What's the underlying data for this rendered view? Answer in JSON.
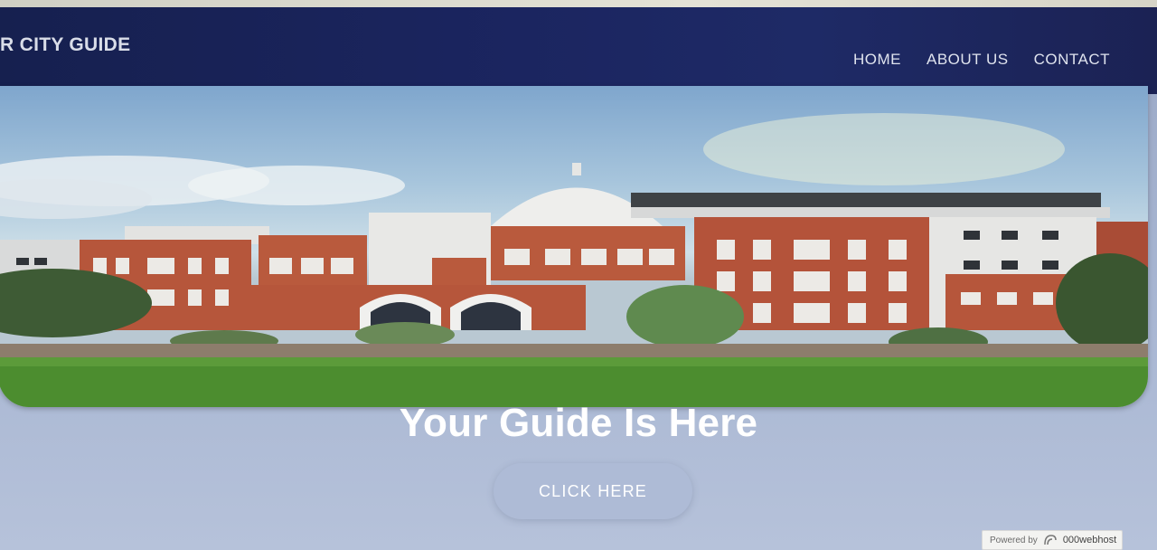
{
  "header": {
    "brand": "R CITY GUIDE",
    "nav": [
      {
        "label": "HOME"
      },
      {
        "label": "ABOUT US"
      },
      {
        "label": "CONTACT"
      }
    ]
  },
  "hero": {
    "image_icon": "campus-building-photo",
    "headline": "Your Guide Is Here",
    "cta_label": "CLICK HERE"
  },
  "footer_badge": {
    "prefix": "Powered by",
    "brand": "000webhost",
    "icon": "000webhost-logo-icon"
  },
  "colors": {
    "navbar": "#1b2560",
    "page_bg": "#a9b7d3",
    "cta_bg": "#aebbd6",
    "text_light": "#ffffff"
  }
}
